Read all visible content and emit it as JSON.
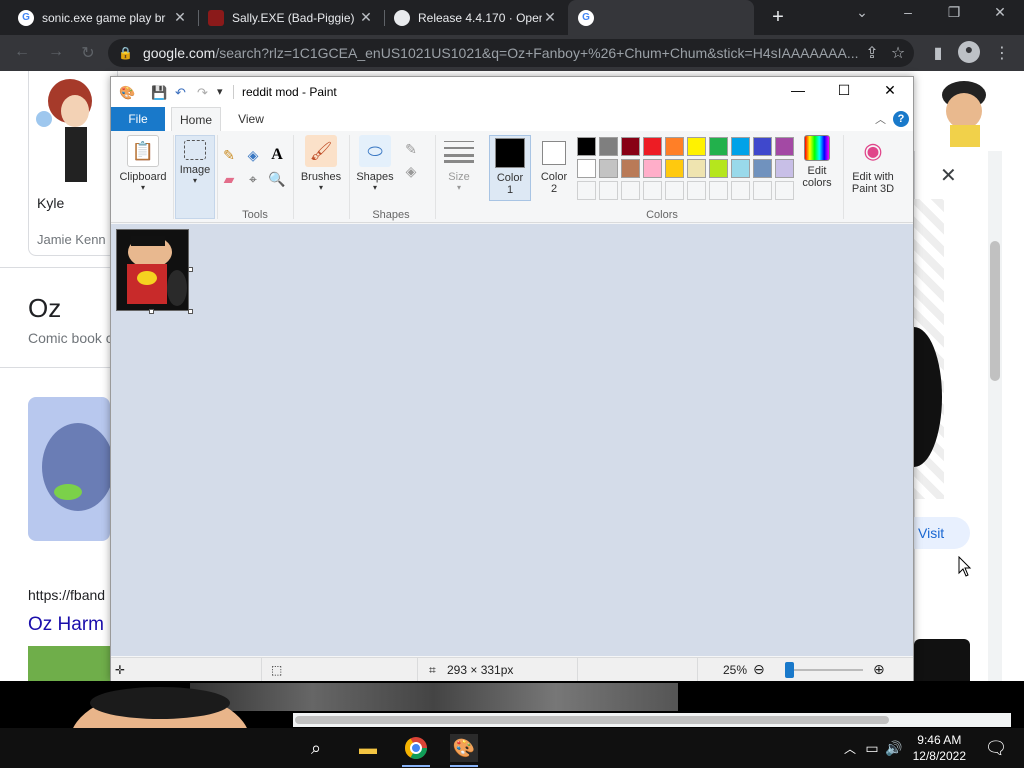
{
  "browser": {
    "tabs": [
      {
        "title": "sonic.exe game play br",
        "favicon": "google-icon"
      },
      {
        "title": "Sally.EXE (Bad-Piggie)",
        "favicon": "deviantart-icon"
      },
      {
        "title": "Release 4.4.170 · Open",
        "favicon": "github-icon"
      },
      {
        "title": "",
        "favicon": "google-icon"
      }
    ],
    "url_host": "google.com",
    "url_path": "/search?rlz=1C1GCEA_enUS1021US1021&q=Oz+Fanboy+%26+Chum+Chum&stick=H4sIAAAAAAA..."
  },
  "google_page": {
    "card_name": "Kyle",
    "card_actor": "Jamie Kenn",
    "heading": "Oz",
    "subheading": "Comic book c",
    "link_url": "https://fband",
    "link_title": "Oz Harm",
    "visit_label": "Visit"
  },
  "paint": {
    "window_title": "reddit mod - Paint",
    "tabs": {
      "file": "File",
      "home": "Home",
      "view": "View"
    },
    "groups": {
      "clipboard": "Clipboard",
      "image": "Image",
      "tools": "Tools",
      "brushes": "Brushes",
      "shapes_btn": "Shapes",
      "shapes_group": "Shapes",
      "size": "Size",
      "color1_a": "Color",
      "color1_b": "1",
      "color2_a": "Color",
      "color2_b": "2",
      "edit_colors_a": "Edit",
      "edit_colors_b": "colors",
      "edit3d_a": "Edit with",
      "edit3d_b": "Paint 3D",
      "colors_group": "Colors"
    },
    "palette_row1": [
      "#000000",
      "#7f7f7f",
      "#880015",
      "#ed1c24",
      "#ff7f27",
      "#fff200",
      "#22b14c",
      "#00a2e8",
      "#3f48cc",
      "#a349a4"
    ],
    "palette_row2": [
      "#ffffff",
      "#c3c3c3",
      "#b97a57",
      "#ffaec9",
      "#ffc90e",
      "#efe4b0",
      "#b5e61d",
      "#99d9ea",
      "#7092be",
      "#c8bfe7"
    ],
    "color1": "#000000",
    "color2": "#ffffff",
    "status": {
      "dimensions": "293 × 331px",
      "zoom": "25%"
    }
  },
  "taskbar": {
    "time": "9:46 AM",
    "date": "12/8/2022"
  }
}
